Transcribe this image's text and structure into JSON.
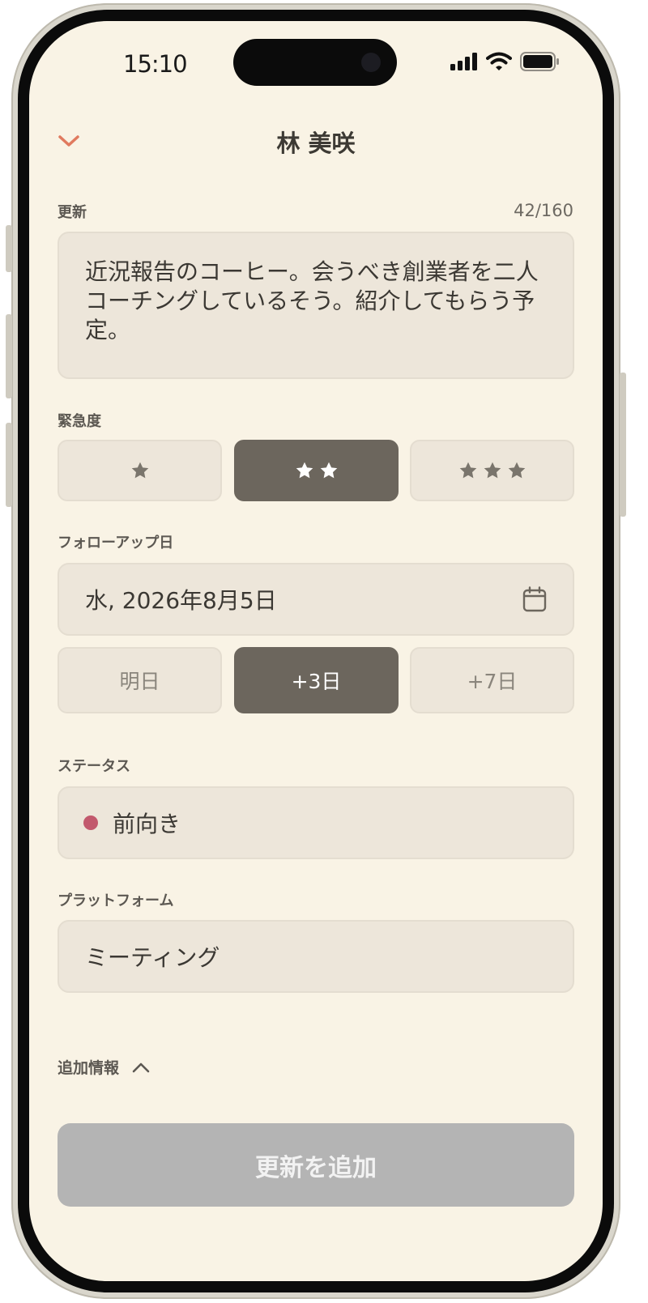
{
  "status_bar": {
    "time": "15:10"
  },
  "header": {
    "title": "林 美咲"
  },
  "update": {
    "label": "更新",
    "counter": "42/160",
    "text": "近況報告のコーヒー。会うべき創業者を二人コーチングしているそう。紹介してもらう予定。"
  },
  "urgency": {
    "label": "緊急度",
    "options": [
      {
        "stars": 1,
        "selected": false
      },
      {
        "stars": 2,
        "selected": true
      },
      {
        "stars": 3,
        "selected": false
      }
    ]
  },
  "follow_up": {
    "label": "フォローアップ日",
    "date": "水, 2026年8月5日",
    "presets": [
      "明日",
      "+3日",
      "+7日"
    ],
    "selected_preset": "+3日"
  },
  "status": {
    "label": "ステータス",
    "value": "前向き",
    "color": "#c2596d"
  },
  "platform": {
    "label": "プラットフォーム",
    "value": "ミーティング"
  },
  "more_info": {
    "label": "追加情報"
  },
  "submit": {
    "label": "更新を追加"
  },
  "colors": {
    "background": "#f9f3e5",
    "field": "#ede6da",
    "selected": "#6c665d",
    "accent": "#e07a5f",
    "disabled_button": "#b4b4b4"
  },
  "icons": [
    "chevron-down-icon",
    "cellular-signal-icon",
    "wifi-icon",
    "battery-icon",
    "star-icon",
    "calendar-icon",
    "chevron-up-icon"
  ]
}
